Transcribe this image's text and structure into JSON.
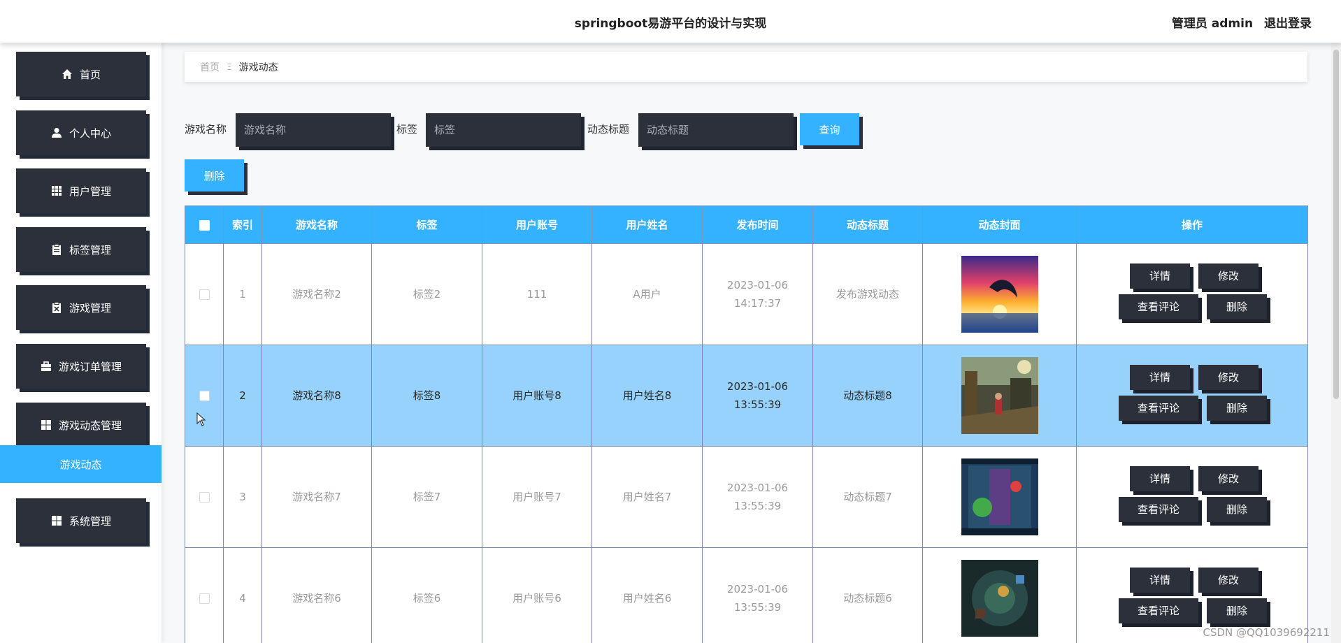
{
  "header": {
    "title": "springboot易游平台的设计与实现",
    "user_label": "管理员 admin",
    "logout_label": "退出登录"
  },
  "sidebar": {
    "items": [
      {
        "label": "首页",
        "icon": "home-icon"
      },
      {
        "label": "个人中心",
        "icon": "user-icon"
      },
      {
        "label": "用户管理",
        "icon": "grid-icon"
      },
      {
        "label": "标签管理",
        "icon": "clipboard-icon"
      },
      {
        "label": "游戏管理",
        "icon": "clipboard-x-icon"
      },
      {
        "label": "游戏订单管理",
        "icon": "briefcase-icon"
      },
      {
        "label": "游戏动态管理",
        "icon": "windows-icon"
      },
      {
        "label": "系统管理",
        "icon": "windows-icon"
      }
    ],
    "active_sub": "游戏动态"
  },
  "breadcrumb": {
    "home": "首页",
    "separator": "Ξ",
    "current": "游戏动态"
  },
  "search": {
    "game_name_label": "游戏名称",
    "game_name_placeholder": "游戏名称",
    "tag_label": "标签",
    "tag_placeholder": "标签",
    "title_label": "动态标题",
    "title_placeholder": "动态标题",
    "query_label": "查询"
  },
  "toolbar": {
    "delete_label": "删除"
  },
  "table": {
    "headers": [
      "索引",
      "游戏名称",
      "标签",
      "用户账号",
      "用户姓名",
      "发布时间",
      "动态标题",
      "动态封面",
      "操作"
    ],
    "rows": [
      {
        "index": "1",
        "game_name": "游戏名称2",
        "tag": "标签2",
        "account": "111",
        "user_name": "A用户",
        "time": "2023-01-06 14:17:37",
        "title": "发布游戏动态",
        "cover": "dolphin-sunset-image"
      },
      {
        "index": "2",
        "game_name": "游戏名称8",
        "tag": "标签8",
        "account": "用户账号8",
        "user_name": "用户姓名8",
        "time": "2023-01-06 13:55:39",
        "title": "动态标题8",
        "cover": "game-screenshot-image"
      },
      {
        "index": "3",
        "game_name": "游戏名称7",
        "tag": "标签7",
        "account": "用户账号7",
        "user_name": "用户姓名7",
        "time": "2023-01-06 13:55:39",
        "title": "动态标题7",
        "cover": "game-screenshot-image"
      },
      {
        "index": "4",
        "game_name": "游戏名称6",
        "tag": "标签6",
        "account": "用户账号6",
        "user_name": "用户姓名6",
        "time": "2023-01-06 13:55:39",
        "title": "动态标题6",
        "cover": "game-screenshot-image"
      }
    ],
    "actions": {
      "detail": "详情",
      "edit": "修改",
      "comments": "查看评论",
      "delete": "删除"
    }
  },
  "watermark": "CSDN @QQ1039692211",
  "colors": {
    "accent": "#34b2ff",
    "dark": "#2b303b",
    "highlight_row": "#96d2fb"
  }
}
